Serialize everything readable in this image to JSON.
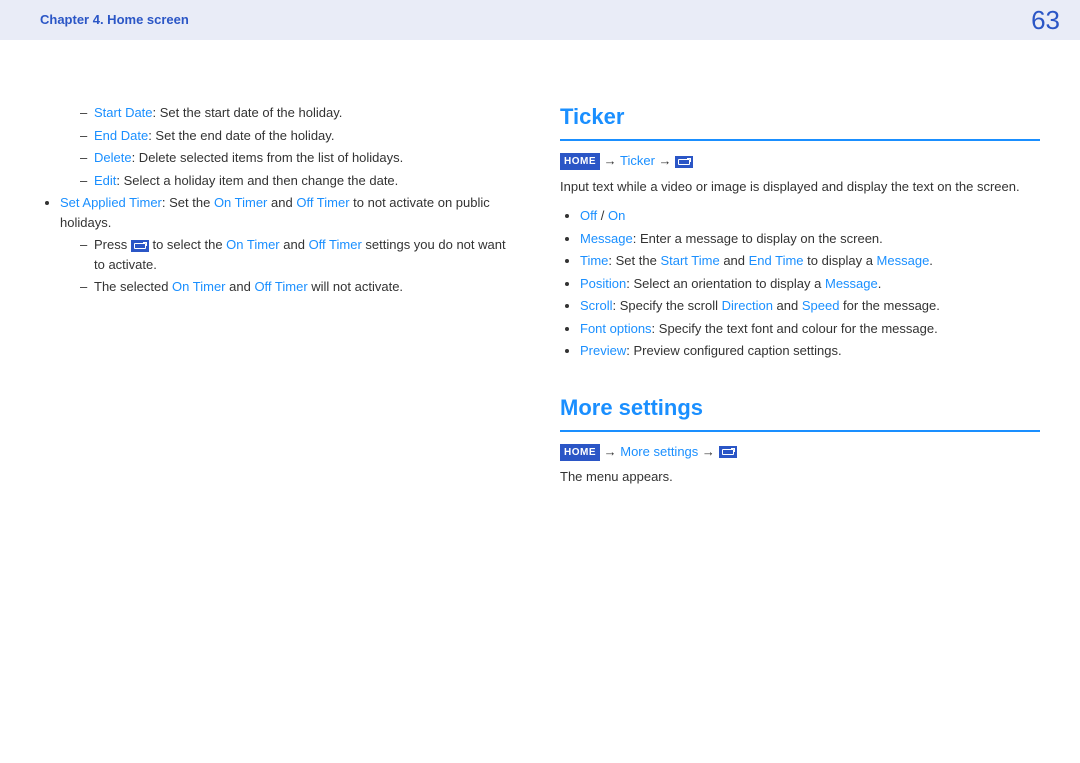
{
  "header": {
    "chapter": "Chapter 4. Home screen",
    "page": "63"
  },
  "left": {
    "d1_label": "Start Date",
    "d1_text": ": Set the start date of the holiday.",
    "d2_label": "End Date",
    "d2_text": ": Set the end date of the holiday.",
    "d3_label": "Delete",
    "d3_text": ": Delete selected items from the list of holidays.",
    "d4_label": "Edit",
    "d4_text": ": Select a holiday item and then change the date.",
    "b1_label": "Set Applied Timer",
    "b1_text1": ": Set the ",
    "b1_on": "On Timer",
    "b1_text2": " and ",
    "b1_off": "Off Timer",
    "b1_text3": " to not activate on public holidays.",
    "sd1_text1": "Press ",
    "sd1_text2": " to select the ",
    "sd1_on": "On Timer",
    "sd1_text3": " and ",
    "sd1_off": "Off Timer",
    "sd1_text4": " settings you do not want to activate.",
    "sd2_text1": "The selected ",
    "sd2_on": "On Timer",
    "sd2_text2": " and ",
    "sd2_off": "Off Timer",
    "sd2_text3": " will not activate."
  },
  "ticker": {
    "heading": "Ticker",
    "home": "HOME",
    "arrow": "→",
    "path_label": "Ticker",
    "intro": "Input text while a video or image is displayed and display the text on the screen.",
    "i1_off": "Off",
    "i1_slash": " / ",
    "i1_on": "On",
    "i2_label": "Message",
    "i2_text": ": Enter a message to display on the screen.",
    "i3_label": "Time",
    "i3_text1": ": Set the ",
    "i3_start": "Start Time",
    "i3_text2": " and ",
    "i3_end": "End Time",
    "i3_text3": " to display a ",
    "i3_msg": "Message",
    "i3_text4": ".",
    "i4_label": "Position",
    "i4_text1": ": Select an orientation to display a ",
    "i4_msg": "Message",
    "i4_text2": ".",
    "i5_label": "Scroll",
    "i5_text1": ": Specify the scroll ",
    "i5_dir": "Direction",
    "i5_text2": " and ",
    "i5_speed": "Speed",
    "i5_text3": " for the message.",
    "i6_label": "Font options",
    "i6_text": ": Specify the text font and colour for the message.",
    "i7_label": "Preview",
    "i7_text": ": Preview configured caption settings."
  },
  "more": {
    "heading": "More settings",
    "home": "HOME",
    "arrow": "→",
    "path_label": "More settings",
    "text": "The menu appears."
  }
}
